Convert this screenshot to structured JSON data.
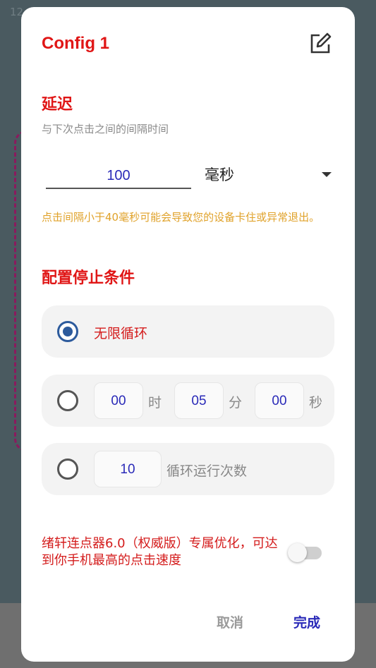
{
  "status_bar": {
    "time": "12"
  },
  "dialog": {
    "title": "Config 1",
    "delay": {
      "heading": "延迟",
      "subtitle": "与下次点击之间的间隔时间",
      "value": "100",
      "unit": "毫秒",
      "warning": "点击间隔小于40毫秒可能会导致您的设备卡住或异常退出。"
    },
    "stop_condition": {
      "heading": "配置停止条件",
      "infinite_label": "无限循环",
      "timer": {
        "hours": "00",
        "hours_unit": "时",
        "minutes": "05",
        "minutes_unit": "分",
        "seconds": "00",
        "seconds_unit": "秒"
      },
      "count": {
        "value": "10",
        "label": "循环运行次数"
      }
    },
    "promo": "绪轩连点器6.0（权威版）专属优化，可达到你手机最高的点击速度",
    "buttons": {
      "cancel": "取消",
      "done": "完成"
    }
  },
  "colors": {
    "accent_red": "#e01616",
    "accent_blue": "#2a2ab8",
    "warning": "#e0a22a"
  }
}
